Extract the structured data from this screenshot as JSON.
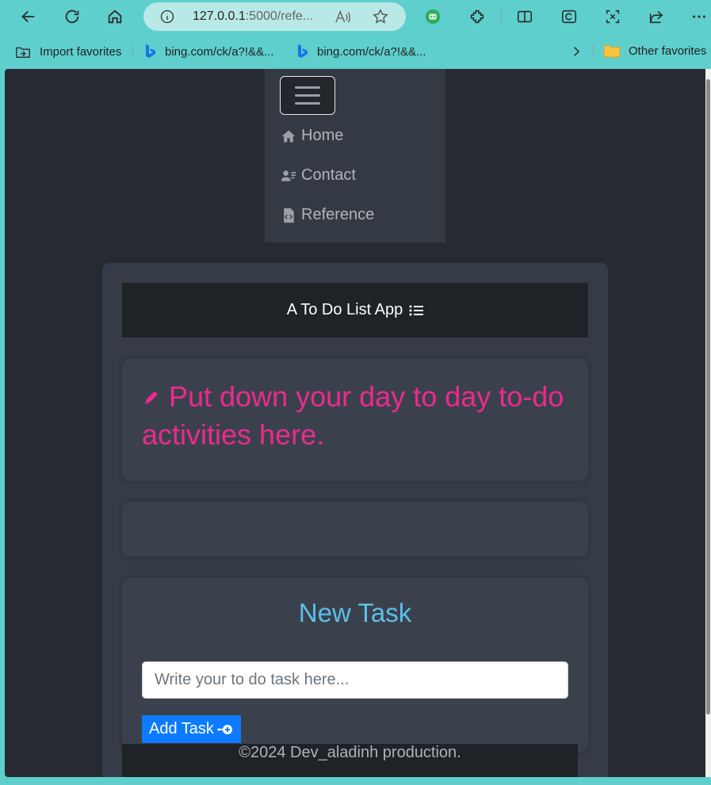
{
  "browser": {
    "address_host": "127.0.0.1",
    "address_rest": ":5000/refe...",
    "favorites": [
      "Import favorites",
      "bing.com/ck/a?!&&...",
      "bing.com/ck/a?!&&..."
    ],
    "other_favorites": "Other favorites"
  },
  "nav": {
    "items": [
      {
        "label": "Home",
        "icon": "house-icon"
      },
      {
        "label": "Contact",
        "icon": "contact-card-icon"
      },
      {
        "label": "Reference",
        "icon": "code-file-icon"
      }
    ]
  },
  "app": {
    "header_title": "A To Do List App",
    "banner_text": "Put down your day to day to-do activities here.",
    "new_task_title": "New Task",
    "input_placeholder": "Write your to do task here...",
    "add_button_label": "Add Task",
    "footer_text": "©2024 Dev_aladinh production."
  },
  "colors": {
    "accent_pink": "#ec2a8e",
    "accent_blue": "#5bc0ea",
    "button_blue": "#0d7bff",
    "browser_frame": "#5ecfcc"
  }
}
